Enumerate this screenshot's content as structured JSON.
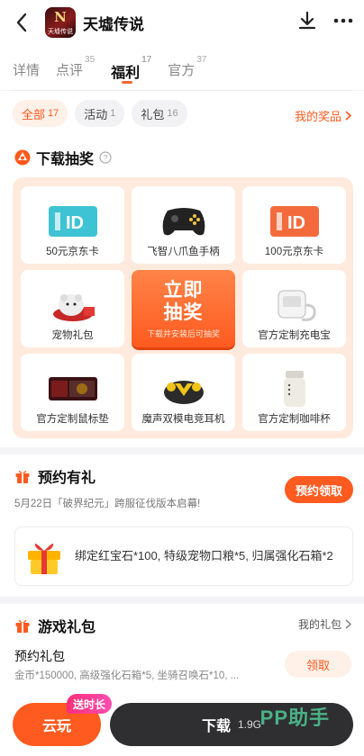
{
  "header": {
    "app_title": "天墟传说",
    "icon_glyph": "N",
    "icon_caption": "天墟传说"
  },
  "tabs": [
    {
      "label": "详情",
      "count": ""
    },
    {
      "label": "点评",
      "count": "35"
    },
    {
      "label": "福利",
      "count": "17"
    },
    {
      "label": "官方",
      "count": "37"
    }
  ],
  "filters": [
    {
      "label": "全部",
      "count": "17"
    },
    {
      "label": "活动",
      "count": "1"
    },
    {
      "label": "礼包",
      "count": "16"
    }
  ],
  "my_prizes": "我的奖品",
  "lottery": {
    "title": "下载抽奖",
    "prizes": [
      "50元京东卡",
      "飞智八爪鱼手柄",
      "100元京东卡",
      "宠物礼包",
      "官方定制充电宝",
      "官方定制鼠标垫",
      "魔声双模电竞耳机",
      "官方定制咖啡杯"
    ],
    "draw_button": "立即抽奖",
    "draw_hint": "下载并安装后可抽奖"
  },
  "reservation": {
    "title": "预约有礼",
    "subtitle": "5月22日「破界纪元」跨服征伐版本启幕!",
    "button": "预约领取",
    "reward_text": "绑定红宝石*100, 特级宠物口粮*5, 归属强化石箱*2"
  },
  "game_gifts": {
    "title": "游戏礼包",
    "my_gifts": "我的礼包",
    "gift_name": "预约礼包",
    "gift_desc": "金币*150000, 高级强化石箱*5, 坐骑召唤石*10, ...",
    "claim": "领取"
  },
  "bottom": {
    "cloud_play": "云玩",
    "cloud_badge": "送时长",
    "download": "下载",
    "size": "1.9G",
    "watermark": "PP助手"
  },
  "colors": {
    "accent": "#ff5a1f",
    "accent_light": "#fff0e8",
    "panel": "#ffeadd",
    "dark_button": "#2f2f32"
  }
}
